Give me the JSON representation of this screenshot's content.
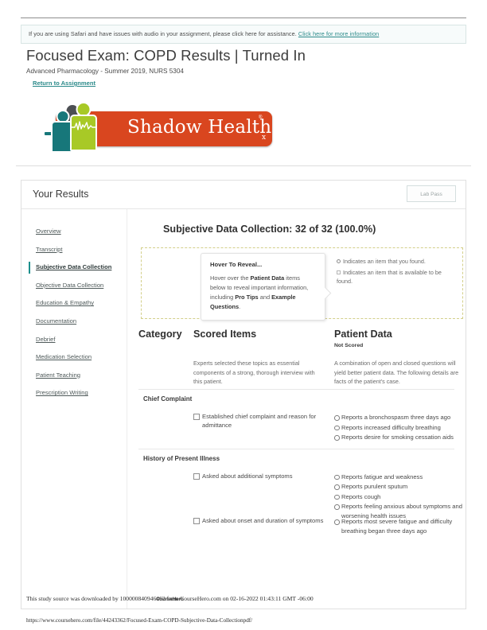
{
  "notice": {
    "text": "If you are using Safari and have issues with audio in your assignment, please click here for assistance. ",
    "link_text": "Click here for more information"
  },
  "header": {
    "title": "Focused Exam: COPD Results | Turned In",
    "subtitle": "Advanced Pharmacology - Summer 2019, NURS 5304",
    "return_link": "Return to Assignment"
  },
  "logo": {
    "text": "Shadow Health",
    "registered": "®",
    "rx": "x",
    "bar_color": "#d9461f",
    "figure_colors": [
      "#4c4f54",
      "#17777a",
      "#a8c926"
    ]
  },
  "results_card": {
    "title": "Your Results",
    "lab_pass_label": "Lab Pass"
  },
  "sidebar": {
    "items": [
      {
        "label": "Overview",
        "active": false
      },
      {
        "label": "Transcript",
        "active": false
      },
      {
        "label": "Subjective Data Collection",
        "active": true
      },
      {
        "label": "Objective Data Collection",
        "active": false
      },
      {
        "label": "Education & Empathy",
        "active": false
      },
      {
        "label": "Documentation",
        "active": false
      },
      {
        "label": "Debrief",
        "active": false
      },
      {
        "label": "Medication Selection",
        "active": false
      },
      {
        "label": "Patient Teaching",
        "active": false
      },
      {
        "label": "Prescription Writing",
        "active": false
      }
    ],
    "active_indicator_color": "#1c8f8c"
  },
  "main": {
    "section_heading": "Subjective Data Collection: 32 of 32 (100.0%)",
    "score_earned": 32,
    "score_total": 32,
    "score_percent": "100.0%",
    "tooltip": {
      "title": "Hover To Reveal...",
      "body_part1": "Hover over the ",
      "body_bold1": "Patient Data",
      "body_part2": " items below to reveal important information, including ",
      "body_bold2": "Pro Tips",
      "body_part3": " and ",
      "body_bold3": "Example Questions",
      "body_part4": "."
    },
    "legend": {
      "found": "Indicates an item that you found.",
      "available": "Indicates an item that is available to be found."
    },
    "columns": {
      "category": "Category",
      "scored_items": "Scored Items",
      "patient_data": "Patient Data",
      "not_scored": "Not Scored",
      "scored_desc": "Experts selected these topics as essential components of a strong, thorough interview with this patient.",
      "patient_desc": "A combination of open and closed questions will yield better patient data. The following details are facts of the patient's case."
    },
    "sections": [
      {
        "title": "Chief Complaint",
        "rows": [
          {
            "scored_item": "Established chief complaint and reason for admittance",
            "patient_data": [
              "Reports a bronchospasm three days ago",
              "Reports increased difficulty breathing",
              "Reports desire for smoking cessation aids"
            ]
          }
        ]
      },
      {
        "title": "History of Present Illness",
        "rows": [
          {
            "scored_item": "Asked about additional symptoms",
            "patient_data": [
              "Reports fatigue and weakness",
              "Reports purulent sputum",
              "Reports cough",
              "Reports feeling anxious about symptoms and worsening health issues"
            ]
          },
          {
            "scored_item": "Asked about onset and duration of symptoms",
            "patient_data": [
              "Reports most severe fatigue and difficulty breathing began three days ago"
            ]
          }
        ]
      }
    ]
  },
  "watermark": {
    "line": "This study source was downloaded by 100000840946462 from CourseHero.com on 02-16-2022 01:43:11 GMT -06:00",
    "brand": "CourseHero",
    "url": "https://www.coursehero.com/file/44243362/Focused-Exam-COPD-Subjective-Data-Collectionpdf/"
  }
}
